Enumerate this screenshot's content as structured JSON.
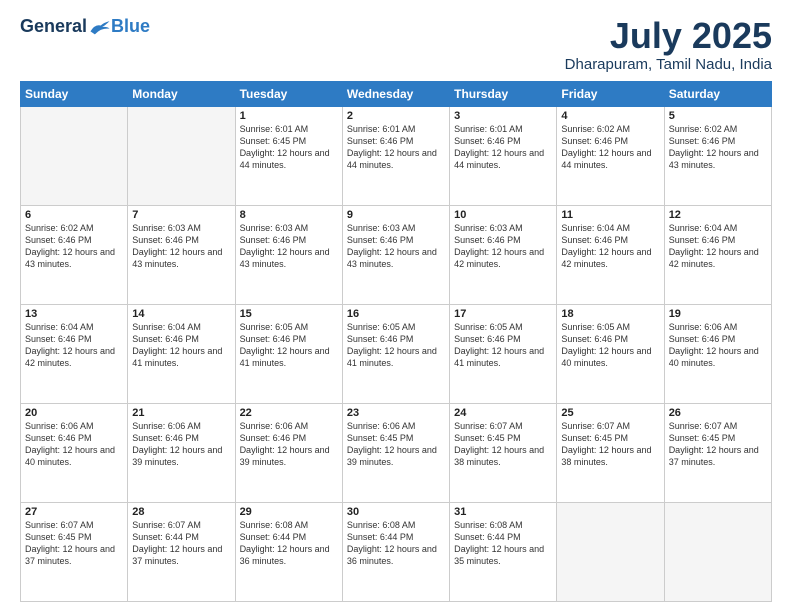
{
  "header": {
    "logo_general": "General",
    "logo_blue": "Blue",
    "month_title": "July 2025",
    "location": "Dharapuram, Tamil Nadu, India"
  },
  "days_of_week": [
    "Sunday",
    "Monday",
    "Tuesday",
    "Wednesday",
    "Thursday",
    "Friday",
    "Saturday"
  ],
  "weeks": [
    [
      {
        "day": "",
        "sunrise": "",
        "sunset": "",
        "daylight": ""
      },
      {
        "day": "",
        "sunrise": "",
        "sunset": "",
        "daylight": ""
      },
      {
        "day": "1",
        "sunrise": "Sunrise: 6:01 AM",
        "sunset": "Sunset: 6:45 PM",
        "daylight": "Daylight: 12 hours and 44 minutes."
      },
      {
        "day": "2",
        "sunrise": "Sunrise: 6:01 AM",
        "sunset": "Sunset: 6:46 PM",
        "daylight": "Daylight: 12 hours and 44 minutes."
      },
      {
        "day": "3",
        "sunrise": "Sunrise: 6:01 AM",
        "sunset": "Sunset: 6:46 PM",
        "daylight": "Daylight: 12 hours and 44 minutes."
      },
      {
        "day": "4",
        "sunrise": "Sunrise: 6:02 AM",
        "sunset": "Sunset: 6:46 PM",
        "daylight": "Daylight: 12 hours and 44 minutes."
      },
      {
        "day": "5",
        "sunrise": "Sunrise: 6:02 AM",
        "sunset": "Sunset: 6:46 PM",
        "daylight": "Daylight: 12 hours and 43 minutes."
      }
    ],
    [
      {
        "day": "6",
        "sunrise": "Sunrise: 6:02 AM",
        "sunset": "Sunset: 6:46 PM",
        "daylight": "Daylight: 12 hours and 43 minutes."
      },
      {
        "day": "7",
        "sunrise": "Sunrise: 6:03 AM",
        "sunset": "Sunset: 6:46 PM",
        "daylight": "Daylight: 12 hours and 43 minutes."
      },
      {
        "day": "8",
        "sunrise": "Sunrise: 6:03 AM",
        "sunset": "Sunset: 6:46 PM",
        "daylight": "Daylight: 12 hours and 43 minutes."
      },
      {
        "day": "9",
        "sunrise": "Sunrise: 6:03 AM",
        "sunset": "Sunset: 6:46 PM",
        "daylight": "Daylight: 12 hours and 43 minutes."
      },
      {
        "day": "10",
        "sunrise": "Sunrise: 6:03 AM",
        "sunset": "Sunset: 6:46 PM",
        "daylight": "Daylight: 12 hours and 42 minutes."
      },
      {
        "day": "11",
        "sunrise": "Sunrise: 6:04 AM",
        "sunset": "Sunset: 6:46 PM",
        "daylight": "Daylight: 12 hours and 42 minutes."
      },
      {
        "day": "12",
        "sunrise": "Sunrise: 6:04 AM",
        "sunset": "Sunset: 6:46 PM",
        "daylight": "Daylight: 12 hours and 42 minutes."
      }
    ],
    [
      {
        "day": "13",
        "sunrise": "Sunrise: 6:04 AM",
        "sunset": "Sunset: 6:46 PM",
        "daylight": "Daylight: 12 hours and 42 minutes."
      },
      {
        "day": "14",
        "sunrise": "Sunrise: 6:04 AM",
        "sunset": "Sunset: 6:46 PM",
        "daylight": "Daylight: 12 hours and 41 minutes."
      },
      {
        "day": "15",
        "sunrise": "Sunrise: 6:05 AM",
        "sunset": "Sunset: 6:46 PM",
        "daylight": "Daylight: 12 hours and 41 minutes."
      },
      {
        "day": "16",
        "sunrise": "Sunrise: 6:05 AM",
        "sunset": "Sunset: 6:46 PM",
        "daylight": "Daylight: 12 hours and 41 minutes."
      },
      {
        "day": "17",
        "sunrise": "Sunrise: 6:05 AM",
        "sunset": "Sunset: 6:46 PM",
        "daylight": "Daylight: 12 hours and 41 minutes."
      },
      {
        "day": "18",
        "sunrise": "Sunrise: 6:05 AM",
        "sunset": "Sunset: 6:46 PM",
        "daylight": "Daylight: 12 hours and 40 minutes."
      },
      {
        "day": "19",
        "sunrise": "Sunrise: 6:06 AM",
        "sunset": "Sunset: 6:46 PM",
        "daylight": "Daylight: 12 hours and 40 minutes."
      }
    ],
    [
      {
        "day": "20",
        "sunrise": "Sunrise: 6:06 AM",
        "sunset": "Sunset: 6:46 PM",
        "daylight": "Daylight: 12 hours and 40 minutes."
      },
      {
        "day": "21",
        "sunrise": "Sunrise: 6:06 AM",
        "sunset": "Sunset: 6:46 PM",
        "daylight": "Daylight: 12 hours and 39 minutes."
      },
      {
        "day": "22",
        "sunrise": "Sunrise: 6:06 AM",
        "sunset": "Sunset: 6:46 PM",
        "daylight": "Daylight: 12 hours and 39 minutes."
      },
      {
        "day": "23",
        "sunrise": "Sunrise: 6:06 AM",
        "sunset": "Sunset: 6:45 PM",
        "daylight": "Daylight: 12 hours and 39 minutes."
      },
      {
        "day": "24",
        "sunrise": "Sunrise: 6:07 AM",
        "sunset": "Sunset: 6:45 PM",
        "daylight": "Daylight: 12 hours and 38 minutes."
      },
      {
        "day": "25",
        "sunrise": "Sunrise: 6:07 AM",
        "sunset": "Sunset: 6:45 PM",
        "daylight": "Daylight: 12 hours and 38 minutes."
      },
      {
        "day": "26",
        "sunrise": "Sunrise: 6:07 AM",
        "sunset": "Sunset: 6:45 PM",
        "daylight": "Daylight: 12 hours and 37 minutes."
      }
    ],
    [
      {
        "day": "27",
        "sunrise": "Sunrise: 6:07 AM",
        "sunset": "Sunset: 6:45 PM",
        "daylight": "Daylight: 12 hours and 37 minutes."
      },
      {
        "day": "28",
        "sunrise": "Sunrise: 6:07 AM",
        "sunset": "Sunset: 6:44 PM",
        "daylight": "Daylight: 12 hours and 37 minutes."
      },
      {
        "day": "29",
        "sunrise": "Sunrise: 6:08 AM",
        "sunset": "Sunset: 6:44 PM",
        "daylight": "Daylight: 12 hours and 36 minutes."
      },
      {
        "day": "30",
        "sunrise": "Sunrise: 6:08 AM",
        "sunset": "Sunset: 6:44 PM",
        "daylight": "Daylight: 12 hours and 36 minutes."
      },
      {
        "day": "31",
        "sunrise": "Sunrise: 6:08 AM",
        "sunset": "Sunset: 6:44 PM",
        "daylight": "Daylight: 12 hours and 35 minutes."
      },
      {
        "day": "",
        "sunrise": "",
        "sunset": "",
        "daylight": ""
      },
      {
        "day": "",
        "sunrise": "",
        "sunset": "",
        "daylight": ""
      }
    ]
  ]
}
